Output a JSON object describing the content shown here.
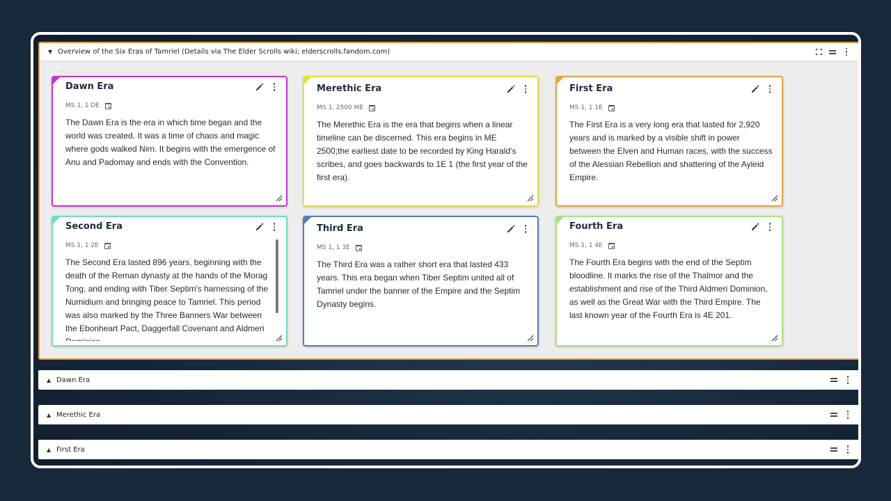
{
  "panel": {
    "title": "Overview of the Six Eras of Tamriel (Details via The Elder Scrolls wiki; elderscrolls.fandom.com)"
  },
  "cards": [
    {
      "title": "Dawn Era",
      "meta": "MS 1, 1 DE",
      "color": "#c535d8",
      "body": "The Dawn Era is the era in which time began and the world was created. It was a time of chaos and magic where gods walked Nirn. It begins with the emergence of Anu and Padomay and ends with the Convention."
    },
    {
      "title": "Merethic Era",
      "meta": "MS 1, 2500 ME",
      "color": "#e6e135",
      "body": "The Merethic Era is the era that begins when a linear timeline can be discerned. This era begins in ME 2500;the earliest date to be recorded by King Harald's scribes, and goes backwards to 1E 1 (the first year of the first era)."
    },
    {
      "title": "First Era",
      "meta": "MS 1, 1 1E",
      "color": "#e8a444",
      "body": "The First Era is a very long era that lasted for 2,920 years and is marked by a visible shift in power between the Elven and Human races, with the success of the Alessian Rebellion and shattering of the Ayleid Empire."
    },
    {
      "title": "Second Era",
      "meta": "MS 1, 1 2E",
      "color": "#6fdcc0",
      "body": "The Second Era lasted 896 years, beginning with the death of the Reman dynasty at the hands of the Morag Tong, and ending with Tiber Septim's harnessing of the Numidium and bringing peace to Tamriel. This period was also marked by the Three Banners War between the Ebonheart Pact, Daggerfall Covenant and Aldmeri Dominion."
    },
    {
      "title": "Third Era",
      "meta": "MS 1, 1 3E",
      "color": "#4a7fc0",
      "body": "The Third Era was a rather short era that lasted 433 years. This era began when Tiber Septim united all of Tamriel under the banner of the Empire and the Septim Dynasty begins."
    },
    {
      "title": "Fourth Era",
      "meta": "MS 1, 1 4E",
      "color": "#a8e080",
      "body": "The Fourth Era begins with the end of the Septim bloodline. It marks the rise of the Thalmor and the establishment and rise of the Third Aldmeri Dominion, as well as the Great War with the Third Empire. The last known year of the Fourth Era is 4E 201."
    }
  ],
  "collapsed_sections": [
    {
      "title": "Dawn Era"
    },
    {
      "title": "Merethic Era"
    },
    {
      "title": "First Era"
    }
  ]
}
